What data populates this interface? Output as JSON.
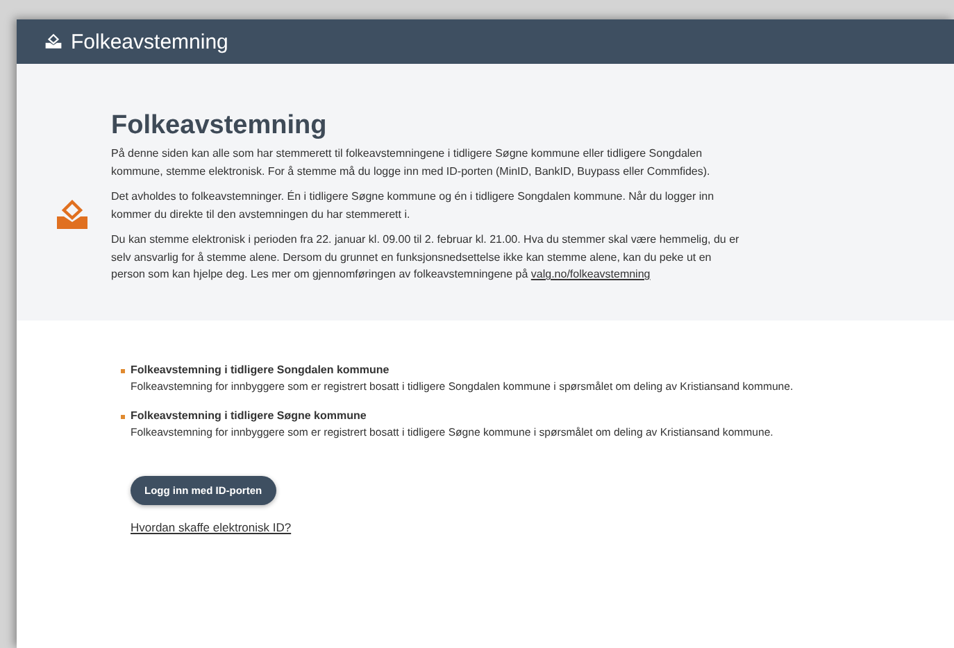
{
  "header": {
    "title": "Folkeavstemning"
  },
  "intro": {
    "heading": "Folkeavstemning",
    "paragraphs": [
      {
        "text": "På denne siden kan alle som har stemmerett til folkeavstemningene i tidligere Søgne kommune eller tidligere Songdalen kommune, stemme elektronisk. For å stemme må du logge inn med ID-porten (MinID, BankID, Buypass eller Commfides)."
      },
      {
        "text": "Det avholdes to folkeavstemninger. Én i tidligere Søgne kommune og én i tidligere Songdalen kommune. Når du logger inn kommer du direkte til den avstemningen du har stemmerett i."
      },
      {
        "text": "Du kan stemme elektronisk i perioden fra 22. januar kl. 09.00 til 2. februar kl. 21.00. Hva du stemmer skal være hemmelig, du er selv ansvarlig for å stemme alene. Dersom du grunnet en funksjonsnedsettelse ikke kan stemme alene, kan du peke ut en person som kan hjelpe deg. Les mer om gjennomføringen av folkeavstemningene på",
        "link": "valg.no/folkeavstemning"
      }
    ]
  },
  "elections": [
    {
      "title": "Folkeavstemning i tidligere Songdalen kommune",
      "description": "Folkeavstemning for innbyggere som er registrert bosatt i tidligere Songdalen kommune i spørsmålet om deling av Kristiansand kommune."
    },
    {
      "title": "Folkeavstemning i tidligere Søgne kommune",
      "description": "Folkeavstemning for innbyggere som er registrert bosatt i tidligere Søgne kommune i spørsmålet om deling av Kristiansand kommune."
    }
  ],
  "login_button": "Logg inn med ID-porten",
  "help_link": "Hvordan skaffe elektronisk ID?"
}
